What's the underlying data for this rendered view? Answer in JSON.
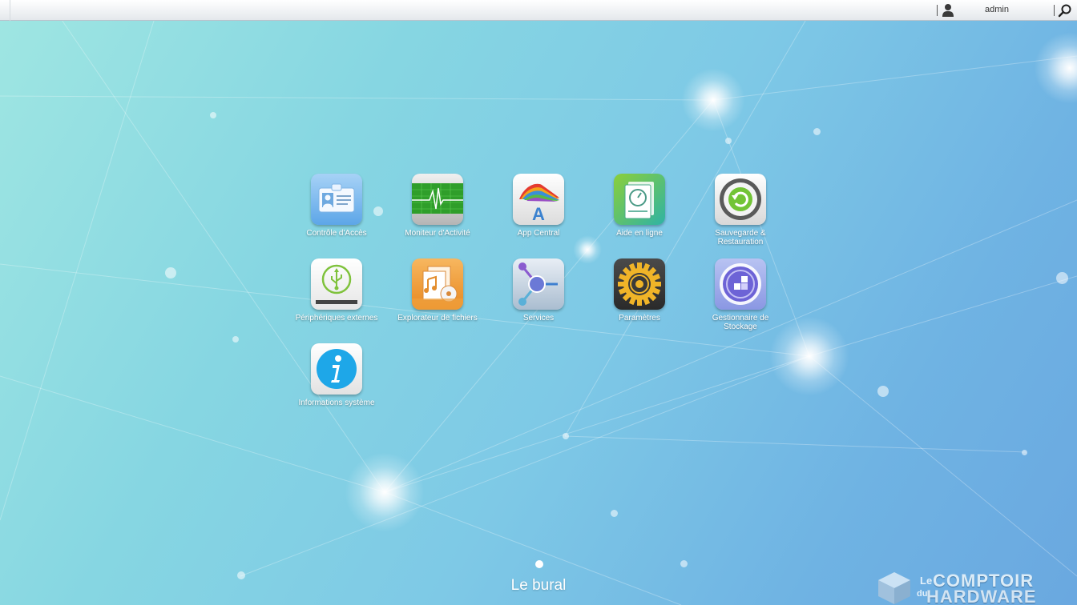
{
  "topbar": {
    "user_icon": "user-icon",
    "username": "admin",
    "search_icon": "search-icon"
  },
  "apps": [
    {
      "label": "Contrôle d'Accès",
      "icon": "id-card-icon"
    },
    {
      "label": "Moniteur d'Activité",
      "icon": "heartbeat-monitor-icon"
    },
    {
      "label": "App Central",
      "icon": "app-central-icon"
    },
    {
      "label": "Aide en ligne",
      "icon": "help-book-icon"
    },
    {
      "label": "Sauvegarde & Restauration",
      "icon": "backup-restore-icon"
    },
    {
      "label": "Périphériques externes",
      "icon": "usb-drive-icon"
    },
    {
      "label": "Explorateur de fichiers",
      "icon": "file-explorer-icon"
    },
    {
      "label": "Services",
      "icon": "services-network-icon"
    },
    {
      "label": "Paramètres",
      "icon": "gear-icon"
    },
    {
      "label": "Gestionnaire de Stockage",
      "icon": "storage-manager-icon"
    },
    {
      "label": "Informations système",
      "icon": "info-icon"
    }
  ],
  "desktop": {
    "name": "Le bural",
    "active_page": 1
  },
  "watermark": {
    "le": "Le",
    "du": "du",
    "line1": "COMPTOIR",
    "line2": "HARDWARE"
  }
}
